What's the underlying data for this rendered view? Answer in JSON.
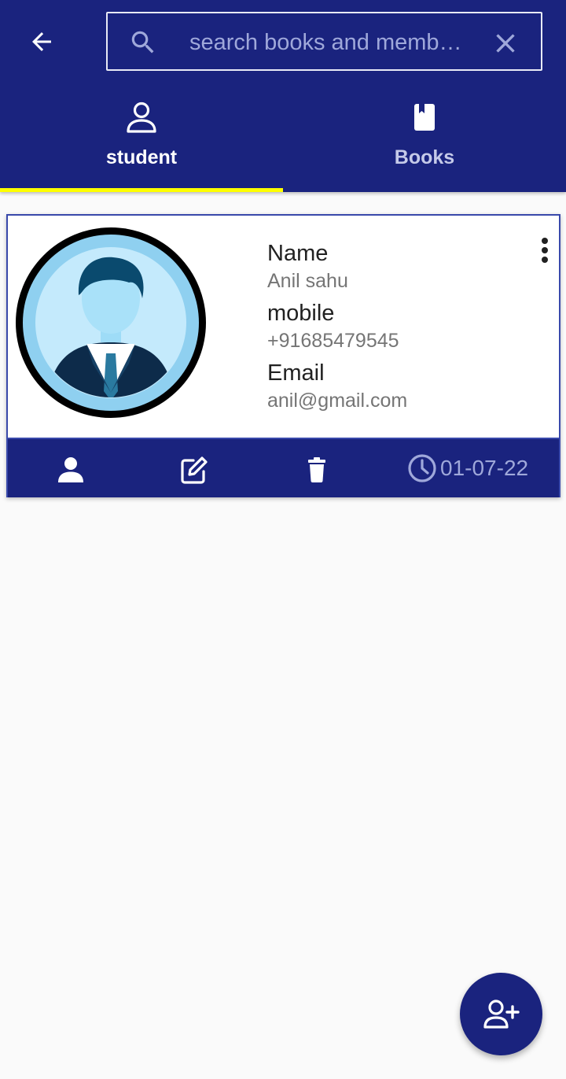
{
  "header": {
    "back_icon": "arrow-left-icon",
    "search": {
      "placeholder": "search books and memb…",
      "value": "",
      "search_icon": "magnifier-icon",
      "clear_icon": "close-icon"
    },
    "tabs": [
      {
        "label": "student",
        "icon": "person-outline-icon",
        "selected": true
      },
      {
        "label": "Books",
        "icon": "book-icon",
        "selected": false
      }
    ],
    "indicator_color": "#ffff00"
  },
  "member_card": {
    "name_label": "Name",
    "name_value": "Anil sahu",
    "mobile_label": "mobile",
    "mobile_value": "+91685479545",
    "email_label": "Email",
    "email_value": "anil@gmail.com",
    "menu_icon": "more-vert-icon",
    "avatar": "businessman-avatar",
    "actions": [
      {
        "icon": "person-icon"
      },
      {
        "icon": "edit-icon"
      },
      {
        "icon": "delete-icon"
      }
    ],
    "date_icon": "clock-icon",
    "date": "01-07-22"
  },
  "fab": {
    "icon": "person-add-icon"
  },
  "colors": {
    "primary": "#1a237e",
    "accent_border": "#3949ab",
    "tab_indicator": "#ffff00",
    "background": "#fafafa",
    "muted_text": "#9fa8da"
  }
}
